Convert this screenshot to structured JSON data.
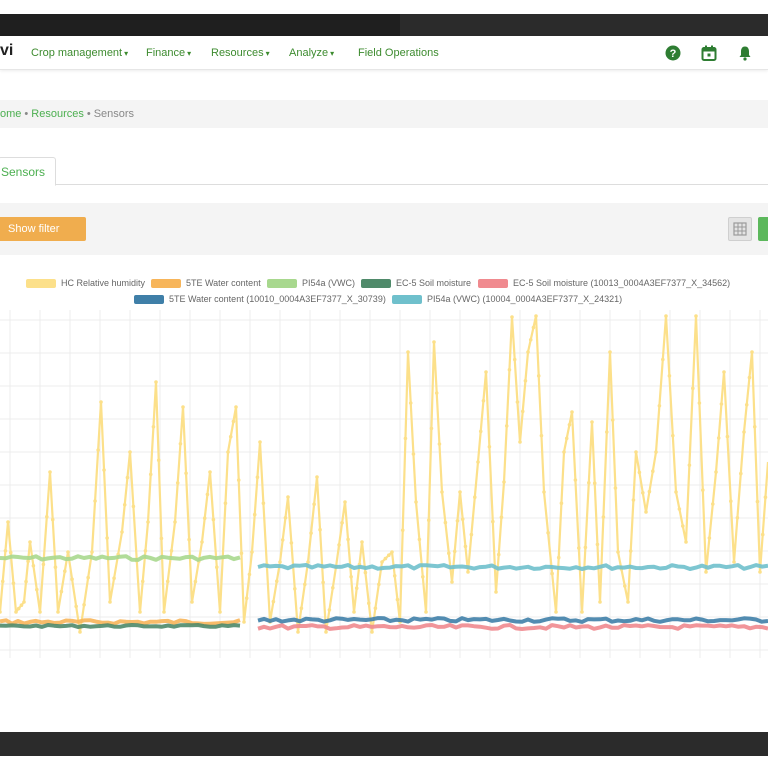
{
  "app": {
    "brand": "vi"
  },
  "nav": {
    "items": [
      {
        "label": "Crop management",
        "caret": "▾"
      },
      {
        "label": "Finance",
        "caret": "▾"
      },
      {
        "label": "Resources",
        "caret": "▾"
      },
      {
        "label": "Analyze",
        "caret": "▾"
      },
      {
        "label": "Field Operations",
        "caret": ""
      }
    ],
    "icons": [
      "help-icon",
      "calendar-icon",
      "bell-icon"
    ],
    "accent": "#3d8b2f"
  },
  "breadcrumb": {
    "items": [
      "Home",
      "Resources",
      "Sensors"
    ],
    "home_visible": "ome",
    "separator": "•"
  },
  "tabs": {
    "active": "Sensors"
  },
  "filter": {
    "show_filter_label": "Show filter",
    "button_color": "#f0ad4e"
  },
  "chart_data": {
    "type": "line",
    "title": "",
    "xlabel": "",
    "ylabel": "",
    "grid": true,
    "legend_position": "top",
    "series": [
      {
        "name": "HC Relative humidity",
        "color": "#fce08a"
      },
      {
        "name": "5TE Water content",
        "color": "#f7b55a"
      },
      {
        "name": "PI54a (VWC)",
        "color": "#a8d88e"
      },
      {
        "name": "EC-5 Soil moisture",
        "color": "#4f8a6a"
      },
      {
        "name": "EC-5 Soil moisture (10013_0004A3EF7377_X_34562)",
        "color": "#f08a8f"
      },
      {
        "name": "5TE Water content (10010_0004A3EF7377_X_30739)",
        "color": "#3f7fa8"
      },
      {
        "name": "PI54a (VWC) (10004_0004A3EF7377_X_24321)",
        "color": "#6fc0cc"
      }
    ]
  }
}
